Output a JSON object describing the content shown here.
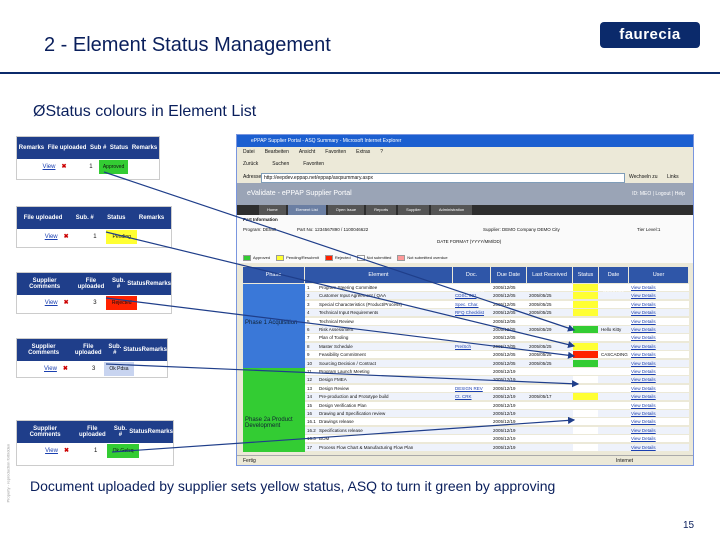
{
  "slide": {
    "title": "2 - Element Status Management",
    "logo": "faurecia",
    "subtitle": "ØStatus colours in Element List",
    "caption": "Document uploaded by supplier sets yellow status, ASQ to turn it green by approving",
    "page_number": "15",
    "side_notice": "Property - reproduction forbidden"
  },
  "colors": {
    "brand": "#0b2a6b",
    "header_blue": "#2f56a8",
    "status_green": "#33cc33",
    "status_yellow": "#ffff33",
    "status_red": "#ff2200",
    "phase_blue": "#3a78d8",
    "phase_green": "#33cc33",
    "arrow": "#1f3e8a"
  },
  "snippets": [
    {
      "headers": [
        "Remarks",
        "File uploaded",
        "Sub #",
        "Status",
        "Remarks"
      ],
      "view": "View",
      "x": "✖",
      "sub": "1",
      "status": "Approved",
      "status_color": "#33cc33"
    },
    {
      "headers": [
        "File uploaded",
        "Sub. #",
        "Status",
        "Remarks"
      ],
      "view": "View",
      "x": "✖",
      "sub": "1",
      "status": "Pending",
      "status_color": "#ffff33"
    },
    {
      "headers": [
        "Supplier Comments",
        "File uploaded",
        "Sub. #",
        "Status",
        "Remarks"
      ],
      "view": "View",
      "x": "✖",
      "sub": "3",
      "status": "Rejected",
      "status_color": "#ff2200"
    },
    {
      "headers": [
        "Supplier Comments",
        "File uploaded",
        "Sub. #",
        "Status",
        "Remarks"
      ],
      "view": "View",
      "x": "✖",
      "sub": "3",
      "status": "Ok Pdsa",
      "status_color": "#c8d4f0"
    },
    {
      "headers": [
        "Supplier Comments",
        "File uploaded",
        "Sub. #",
        "Status",
        "Remarks"
      ],
      "view": "View",
      "x": "✖",
      "sub": "1",
      "status": "Ok Gelsq",
      "status_color": "#33cc33"
    }
  ],
  "browser": {
    "window_title": "ePPAP Supplier Portal - ASQ Summary - Microsoft Internet Explorer",
    "menu": [
      "Datei",
      "Bearbeiten",
      "Ansicht",
      "Favoriten",
      "Extras",
      "?"
    ],
    "toolbar_items": [
      "Zurück",
      "Suchen",
      "Favoriten"
    ],
    "address_label": "Adresse",
    "url": "http://eepdev.eppap.net/eppap/asqsummary.aspx",
    "go_label": "Wechseln zu",
    "links_label": "Links",
    "portal_title": "eValidate - ePPAP Supplier Portal",
    "portal_user": "ID: MEO | Logout | Help",
    "nav_tabs": [
      "Home",
      "Element List",
      "Open Issue",
      "Reports",
      "Supplier",
      "Administration"
    ],
    "info": {
      "section": "Part Information",
      "program": "Program: DEMO",
      "part": "Part No: 1234567890 / 1100046622",
      "supplier": "Supplier: DEMO Company  DEMO City",
      "level": "Tier Level:1",
      "date_format": "DATE FORMAT (YYYY/MM/DD)"
    },
    "legend": [
      {
        "label": "Approved",
        "color": "#33cc33"
      },
      {
        "label": "Pending/Resubmit",
        "color": "#ffff33"
      },
      {
        "label": "Rejected",
        "color": "#ff2200"
      },
      {
        "label": "Not submitted",
        "color": "#ffffff"
      },
      {
        "label": "Not submitted overdue",
        "color": "#ff9999"
      }
    ],
    "status_bar": "Fertig",
    "zone": "Internet"
  },
  "grid": {
    "headers": [
      "Phase",
      "Element",
      "Doc. Submitted",
      "Due Date",
      "Last Received",
      "Status",
      "Date Committ.",
      "User"
    ],
    "phases": [
      {
        "label": "Phase 1 Acquisition",
        "color": "#3a78d8",
        "rows": 10
      },
      {
        "label": "Phase 2a Product Development",
        "color": "#33cc33",
        "rows": 13
      }
    ],
    "rows": [
      {
        "no": "1",
        "element": "Program Steering Committee",
        "doc": "",
        "due": "2005/12/05",
        "last": "",
        "status": "#ffff33",
        "action": "View Details"
      },
      {
        "no": "2",
        "element": "Customer Input Agreement / QAA",
        "doc": "CDSC 001",
        "due": "2005/12/05",
        "last": "2005/05/25",
        "status": "#ffff33",
        "action": "View Details"
      },
      {
        "no": "3",
        "element": "Special Characteristics (Product/Process)",
        "doc": "Spec. Char.",
        "due": "2005/12/05",
        "last": "2005/05/25",
        "status": "#ffff33",
        "action": "View Details"
      },
      {
        "no": "4",
        "element": "Technical Input Requirements",
        "doc": "RFQ Checklist",
        "due": "2005/12/05",
        "last": "2005/05/25",
        "status": "#ffff33",
        "action": "View Details"
      },
      {
        "no": "5",
        "element": "Technical Review",
        "doc": "",
        "due": "2005/12/05",
        "last": "",
        "status": "#ffffff",
        "action": "View Details"
      },
      {
        "no": "6",
        "element": "Risk Assessment",
        "doc": "",
        "due": "2005/12/05",
        "last": "2005/05/29",
        "status": "#33cc33",
        "action": "View Details",
        "committ": "Hello Kitty"
      },
      {
        "no": "7",
        "element": "Plan of Tooling",
        "doc": "",
        "due": "2005/12/05",
        "last": "",
        "status": "#ffffff",
        "action": "View Details"
      },
      {
        "no": "8",
        "element": "Master Schedule",
        "doc": "Pre/Sch",
        "due": "2005/12/05",
        "last": "2005/05/25",
        "status": "#ffff33",
        "action": "View Details"
      },
      {
        "no": "9",
        "element": "Feasibility Commitment",
        "doc": "",
        "due": "2005/12/05",
        "last": "2005/05/25",
        "status": "#ff2200",
        "action": "View Details",
        "committ": "CASCADING"
      },
      {
        "no": "10",
        "element": "Sourcing Decision / Contract",
        "doc": "",
        "due": "2005/12/05",
        "last": "2005/05/25",
        "status": "#33cc33",
        "action": "View Details"
      },
      {
        "no": "11",
        "element": "Program Launch Meeting",
        "doc": "",
        "due": "2005/12/19",
        "last": "",
        "status": "#ffffff",
        "action": "View Details"
      },
      {
        "no": "12",
        "element": "Design FMEA",
        "doc": "",
        "due": "2005/12/19",
        "last": "",
        "status": "#ffffff",
        "action": "View Details"
      },
      {
        "no": "13",
        "element": "Design Review",
        "doc": "DESIGN REV",
        "due": "2005/12/19",
        "last": "",
        "status": "#ffffff",
        "action": "View Details"
      },
      {
        "no": "14",
        "element": "Pre-production and Prototype build",
        "doc": "Ct. CRK",
        "due": "2005/12/19",
        "last": "2005/05/17",
        "status": "#ffff33",
        "action": "View Details"
      },
      {
        "no": "15",
        "element": "Design Verification Plan",
        "doc": "",
        "due": "2005/12/19",
        "last": "",
        "status": "#ffffff",
        "action": "View Details"
      },
      {
        "no": "16",
        "element": "Drawing and Specification review",
        "doc": "",
        "due": "2005/12/19",
        "last": "",
        "status": "#ffffff",
        "action": "View Details"
      },
      {
        "no": "16.1",
        "element": "Drawings release",
        "doc": "",
        "due": "2005/12/19",
        "last": "",
        "status": "#ffffff",
        "action": "View Details"
      },
      {
        "no": "16.2",
        "element": "Specifications release",
        "doc": "",
        "due": "2005/12/19",
        "last": "",
        "status": "#ffffff",
        "action": "View Details"
      },
      {
        "no": "16.3",
        "element": "BOM",
        "doc": "",
        "due": "2005/12/19",
        "last": "",
        "status": "#ffffff",
        "action": "View Details"
      },
      {
        "no": "17",
        "element": "Process Flow Chart & Manufacturing Flow Plan",
        "doc": "",
        "due": "2005/12/19",
        "last": "",
        "status": "#ffffff",
        "action": "View Details"
      }
    ]
  }
}
